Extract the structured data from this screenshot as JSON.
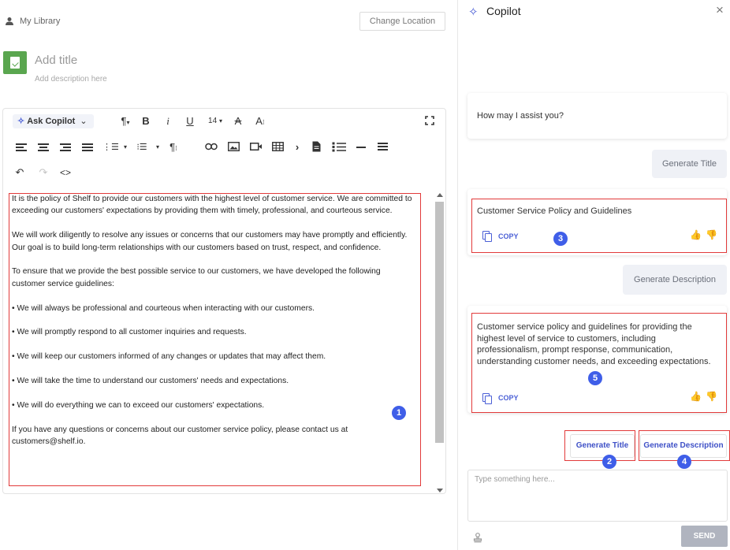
{
  "library": {
    "label": "My Library",
    "change_location": "Change Location"
  },
  "document": {
    "title_placeholder": "Add title",
    "description_placeholder": "Add description here"
  },
  "toolbar": {
    "ask_copilot": "Ask Copilot",
    "font_size": "14",
    "icons": [
      "paragraph-icon",
      "bold-icon",
      "italic-icon",
      "underline-icon",
      "clear-format-icon",
      "text-size-icon",
      "fullscreen-icon",
      "align-left-icon",
      "align-center-icon",
      "align-right-icon",
      "justify-icon",
      "ordered-list-icon",
      "bullet-list-icon",
      "paragraph-format-icon",
      "link-icon",
      "image-icon",
      "video-icon",
      "table-icon",
      "more-icon",
      "file-icon",
      "checklist-icon",
      "horizontal-line-icon",
      "line-height-icon",
      "undo-icon",
      "redo-icon",
      "code-view-icon"
    ]
  },
  "content": {
    "paragraphs": [
      "It is the policy of Shelf to provide our customers with the highest level of customer service. We are committed to exceeding our customers' expectations by providing them with timely, professional, and courteous service.",
      "We will work diligently to resolve any issues or concerns that our customers may have promptly and efficiently. Our goal is to build long-term relationships with our customers based on trust, respect, and confidence.",
      "To ensure that we provide the best possible service to our customers, we have developed the following customer service guidelines:",
      "• We will always be professional and courteous when interacting with our customers.",
      "• We will promptly respond to all customer inquiries and requests.",
      "• We will keep our customers informed of any changes or updates that may affect them.",
      "• We will take the time to understand our customers' needs and expectations.",
      "• We will do everything we can to exceed our customers' expectations.",
      "If you have any questions or concerns about our customer service policy, please contact us at customers@shelf.io."
    ]
  },
  "copilot": {
    "title": "Copilot",
    "greeting": "How may I assist you?",
    "user_msg_1": "Generate Title",
    "response_1": "Customer Service Policy and Guidelines",
    "copy_label": "COPY",
    "user_msg_2": "Generate Description",
    "response_2": "Customer service policy and guidelines for providing the highest level of service to customers, including professionalism, prompt response, communication, understanding customer needs, and exceeding expectations.",
    "generate_title_button": "Generate Title",
    "generate_description_button": "Generate Description",
    "input_placeholder": "Type something here...",
    "send_button": "SEND"
  },
  "annotations": [
    "1",
    "2",
    "3",
    "4",
    "5"
  ],
  "colors": {
    "accent": "#4a5fd6",
    "annotation_box": "#e23a3a",
    "annotation_dot": "#3f5ee8",
    "doc_badge": "#5aa64f"
  }
}
